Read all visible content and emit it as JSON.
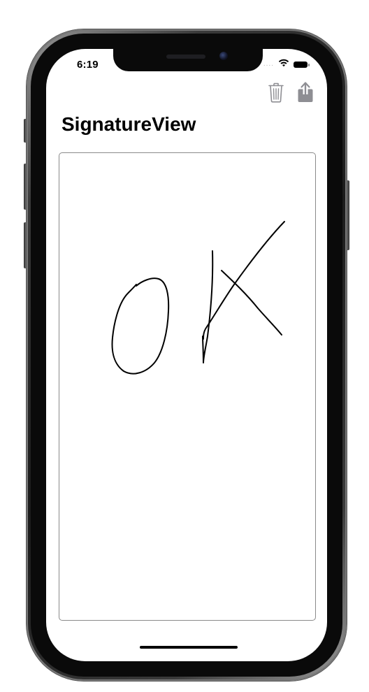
{
  "status_bar": {
    "time": "6:19",
    "signal_dots": "....",
    "icons": [
      "wifi-icon",
      "battery-icon"
    ]
  },
  "toolbar": {
    "buttons": [
      {
        "icon": "trash-icon",
        "action": "clear"
      },
      {
        "icon": "share-icon",
        "action": "share"
      }
    ],
    "tint_color": "#8e8e93"
  },
  "navigation": {
    "title": "SignatureView"
  },
  "signature_pad": {
    "border_color": "#8a8a8a",
    "ink_color": "#000000",
    "content": "handwritten OK"
  }
}
